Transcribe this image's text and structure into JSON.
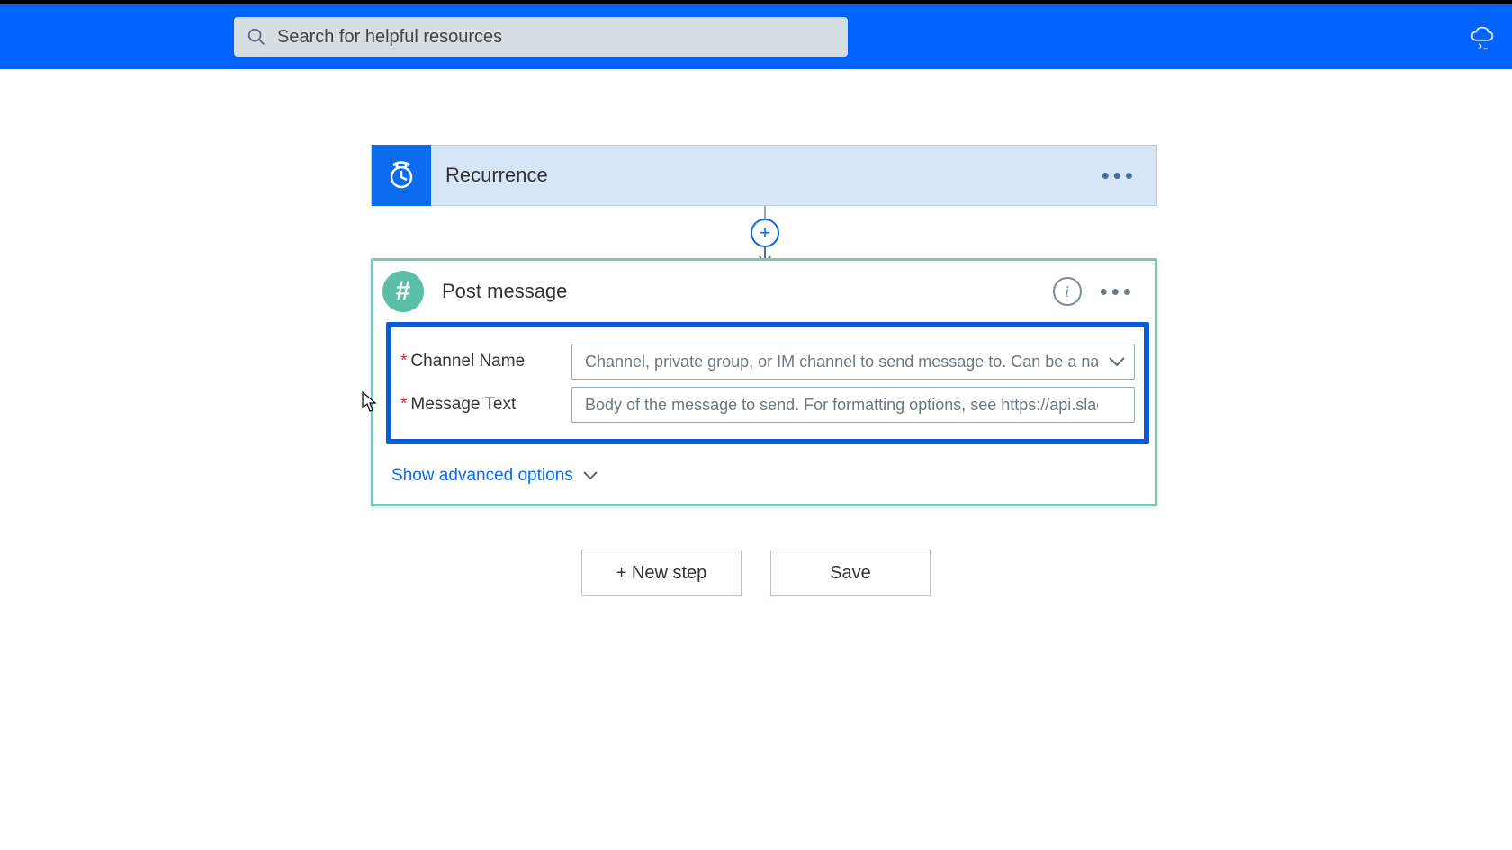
{
  "search": {
    "placeholder": "Search for helpful resources"
  },
  "step1": {
    "title": "Recurrence"
  },
  "step2": {
    "title": "Post message",
    "fields": {
      "channel_label": "Channel Name",
      "channel_placeholder": "Channel, private group, or IM channel to send message to. Can be a nam",
      "message_label": "Message Text",
      "message_placeholder": "Body of the message to send. For formatting options, see https://api.slack.com"
    },
    "advanced_label": "Show advanced options"
  },
  "buttons": {
    "new_step": "+ New step",
    "save": "Save"
  }
}
